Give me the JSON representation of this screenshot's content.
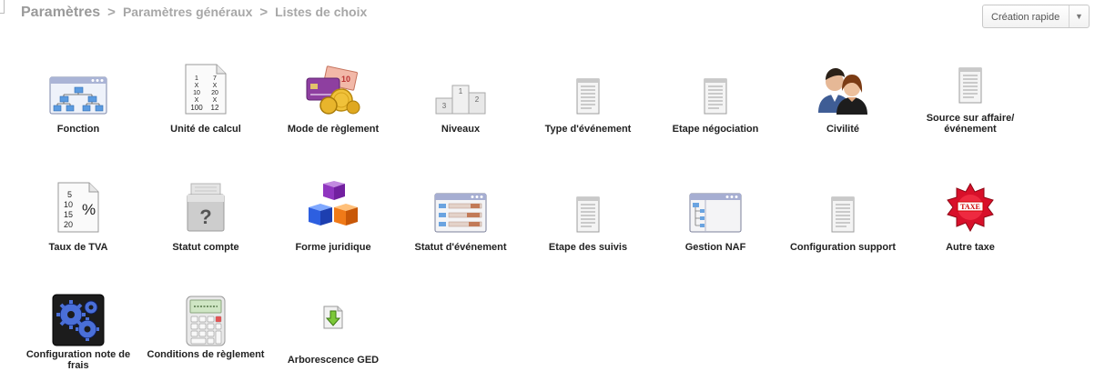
{
  "breadcrumb": {
    "root": "Paramètres",
    "level1": "Paramètres généraux",
    "level2": "Listes de choix",
    "separator": ">"
  },
  "quick_create": {
    "label": "Création rapide",
    "arrow": "▼"
  },
  "tiles": [
    {
      "label": "Fonction",
      "icon": "org-chart-window-icon"
    },
    {
      "label": "Unité de calcul",
      "icon": "numbers-document-icon"
    },
    {
      "label": "Mode de règlement",
      "icon": "payment-money-icon"
    },
    {
      "label": "Niveaux",
      "icon": "podium-icon"
    },
    {
      "label": "Type d'événement",
      "icon": "list-document-icon"
    },
    {
      "label": "Etape négociation",
      "icon": "list-document-icon"
    },
    {
      "label": "Civilité",
      "icon": "people-icon"
    },
    {
      "label": "Source sur affaire/ événement",
      "icon": "list-document-icon"
    },
    {
      "label": "Taux de TVA",
      "icon": "percent-document-icon"
    },
    {
      "label": "Statut compte",
      "icon": "question-box-icon"
    },
    {
      "label": "Forme juridique",
      "icon": "cubes-icon"
    },
    {
      "label": "Statut d'événement",
      "icon": "status-window-icon"
    },
    {
      "label": "Etape des suivis",
      "icon": "list-document-icon"
    },
    {
      "label": "Gestion NAF",
      "icon": "tree-window-icon"
    },
    {
      "label": "Configuration support",
      "icon": "list-document-icon"
    },
    {
      "label": "Autre taxe",
      "icon": "tax-seal-icon"
    },
    {
      "label": "Configuration note de frais",
      "icon": "gears-icon"
    },
    {
      "label": "Conditions de règlement",
      "icon": "calculator-icon"
    },
    {
      "label": "Arborescence GED",
      "icon": "download-document-icon"
    }
  ],
  "icon_text": {
    "numbers_left": [
      "1",
      "X",
      "10",
      "X",
      "100"
    ],
    "numbers_right": [
      "7",
      "X",
      "20",
      "X",
      "12"
    ],
    "podium": [
      "1",
      "2",
      "3"
    ],
    "money": "10",
    "tva_numbers": [
      "5",
      "10",
      "15",
      "20"
    ],
    "percent": "%",
    "question": "?",
    "taxe": "TAXE"
  }
}
